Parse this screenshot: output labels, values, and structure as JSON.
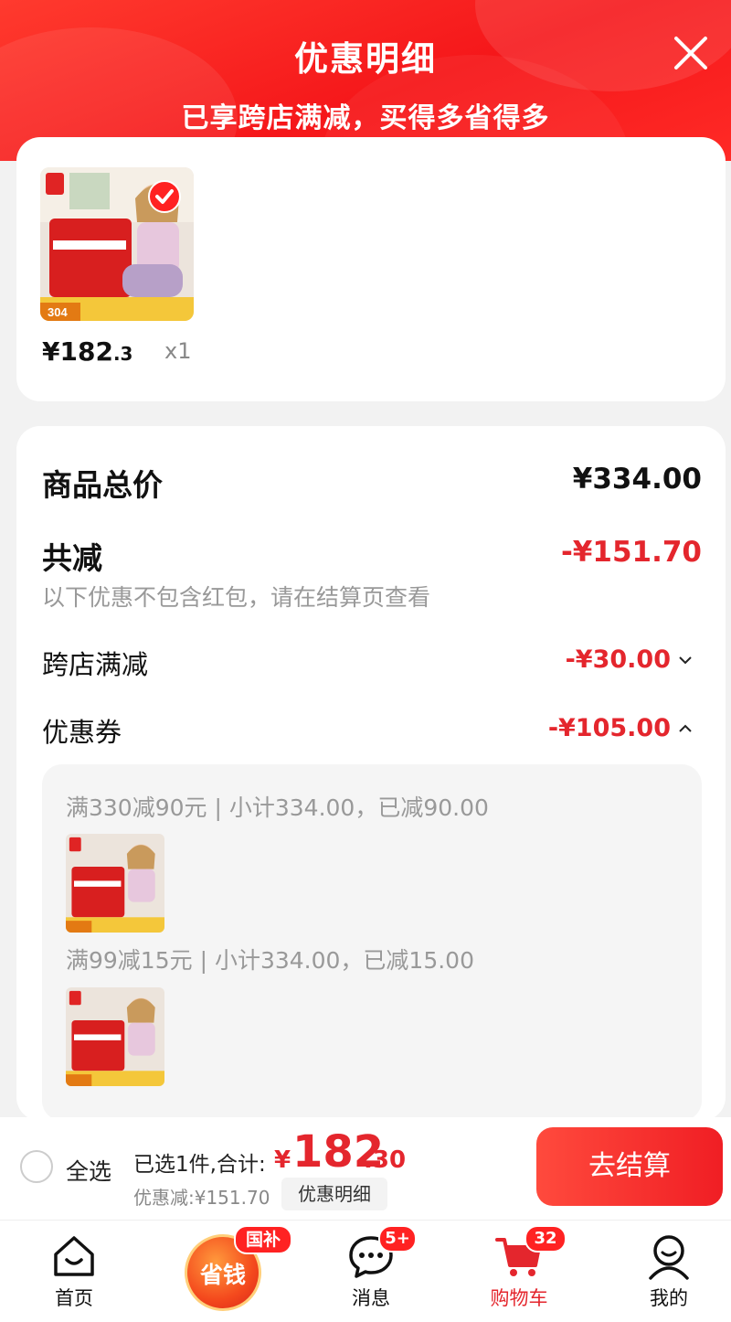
{
  "header": {
    "title": "优惠明细",
    "subtitle": "已享跨店满减，买得多省得多"
  },
  "product": {
    "price_integer": "¥182",
    "price_decimal": ".3",
    "quantity": "x1"
  },
  "summary": {
    "total_label": "商品总价",
    "total_value": "¥334.00",
    "reduce_label": "共减",
    "reduce_value": "-¥151.70",
    "note": "以下优惠不包含红包，请在结算页查看",
    "cross_store_label": "跨店满减",
    "cross_store_value": "-¥30.00",
    "coupon_label": "优惠券",
    "coupon_value": "-¥105.00"
  },
  "coupons": [
    {
      "text": "满330减90元 | 小计334.00，已减90.00"
    },
    {
      "text": "满99减15元 | 小计334.00，已减15.00"
    }
  ],
  "checkout": {
    "select_all": "全选",
    "summary_prefix": "已选1件,合计:",
    "currency": "¥",
    "total_integer": "182",
    "total_decimal": ".30",
    "discount": "优惠减:¥151.70",
    "detail_button": "优惠明细",
    "pay_button": "去结算"
  },
  "tabs": {
    "home": "首页",
    "save_badge": "国补",
    "save_label": "省钱",
    "messages": "消息",
    "messages_badge": "5+",
    "cart": "购物车",
    "cart_badge": "32",
    "me": "我的"
  },
  "colors": {
    "accent": "#e4262d",
    "header": "#f5171a"
  }
}
